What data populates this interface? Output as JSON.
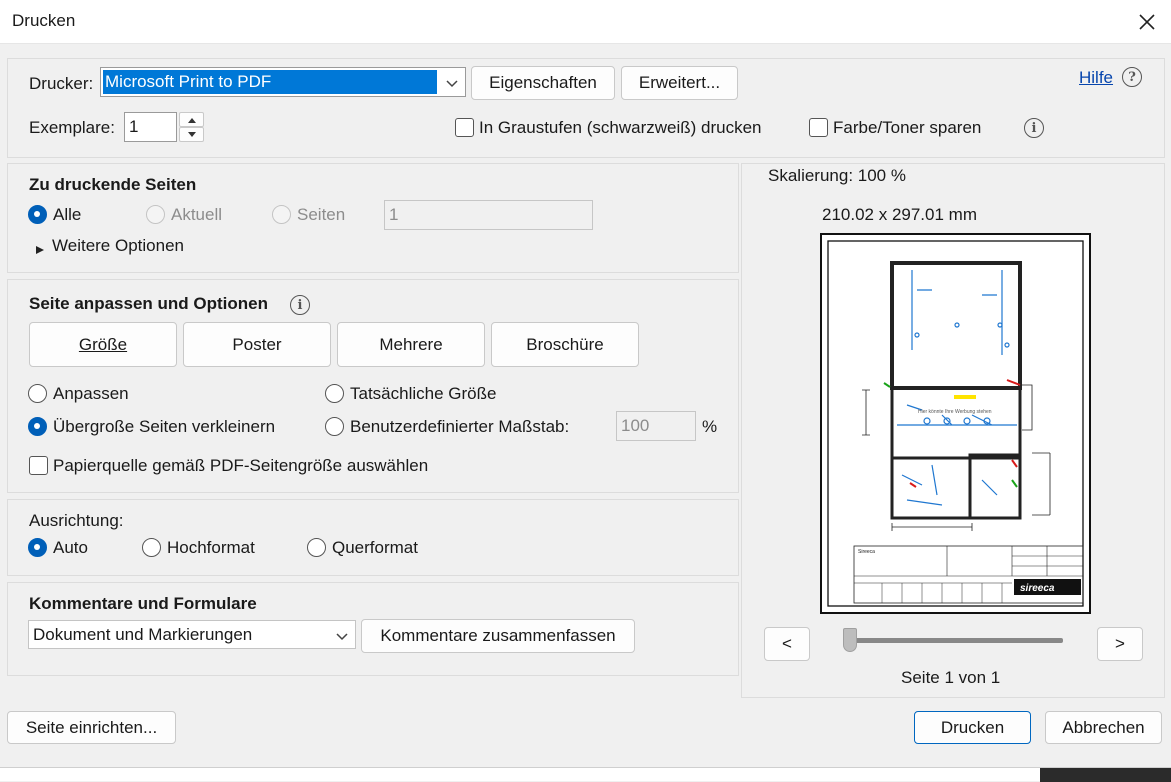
{
  "window": {
    "title": "Drucken"
  },
  "printer": {
    "label": "Drucker:",
    "selected": "Microsoft Print to PDF",
    "properties_button": "Eigenschaften",
    "advanced_button": "Erweitert...",
    "help_link": "Hilfe",
    "copies_label": "Exemplare:",
    "copies_value": "1",
    "grayscale_label": "In Graustufen (schwarzweiß) drucken",
    "save_toner_label": "Farbe/Toner sparen"
  },
  "pages": {
    "heading": "Zu druckende Seiten",
    "all_label": "Alle",
    "current_label": "Aktuell",
    "pages_label": "Seiten",
    "pages_value": "1",
    "more_options": "Weitere Optionen"
  },
  "fit": {
    "heading": "Seite anpassen und Optionen",
    "tab_size": "Größe",
    "tab_poster": "Poster",
    "tab_multiple": "Mehrere",
    "tab_booklet": "Broschüre",
    "fit_label": "Anpassen",
    "actual_size_label": "Tatsächliche Größe",
    "shrink_label": "Übergroße Seiten verkleinern",
    "custom_scale_label": "Benutzerdefinierter Maßstab:",
    "custom_scale_value": "100",
    "percent": "%",
    "paper_source_label": "Papierquelle gemäß PDF-Seitengröße auswählen"
  },
  "orientation": {
    "heading": "Ausrichtung:",
    "auto_label": "Auto",
    "portrait_label": "Hochformat",
    "landscape_label": "Querformat"
  },
  "comments": {
    "heading": "Kommentare und Formulare",
    "selected": "Dokument und Markierungen",
    "summarize_button": "Kommentare zusammenfassen"
  },
  "preview": {
    "scaling": "Skalierung: 100 %",
    "dimensions": "210.02 x 297.01 mm",
    "prev": "<",
    "next": ">",
    "page_info": "Seite 1 von 1",
    "plan_text": "Hier könnte Ihre Werbung stehen",
    "title_block_name": "Sireeca",
    "logo_text": "sireeca"
  },
  "footer": {
    "page_setup_button": "Seite einrichten...",
    "print_button": "Drucken",
    "cancel_button": "Abbrechen"
  },
  "colors": {
    "accent": "#005fb8",
    "link": "#0645ad",
    "selection": "#0078d7"
  }
}
